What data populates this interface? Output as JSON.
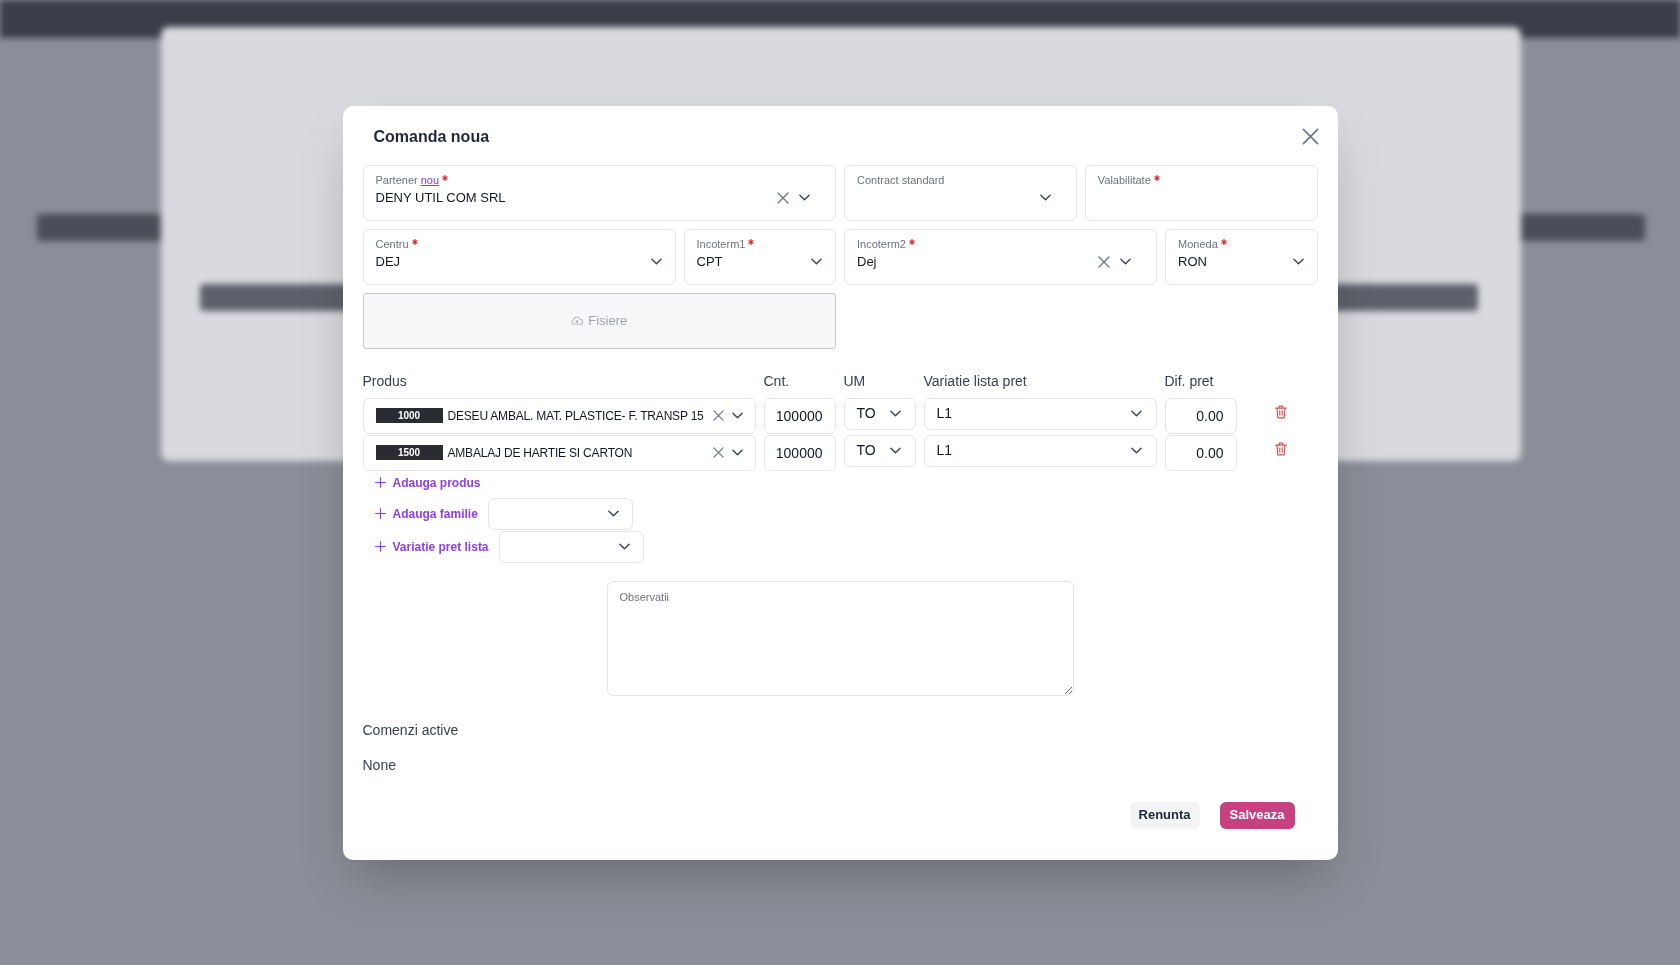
{
  "dialog": {
    "title": "Comanda noua",
    "header_fields": [
      {
        "kind": "select",
        "label": "Partener",
        "link": "nou",
        "required": true,
        "value": "DENY UTIL COM SRL",
        "clearable": true
      },
      {
        "kind": "select",
        "label": "Contract standard",
        "required": false,
        "clearable": false
      },
      {
        "kind": "input",
        "label": "Valabilitate",
        "required": true,
        "clearable": false
      },
      {
        "kind": "select",
        "label": "Centru",
        "required": true,
        "value": "DEJ",
        "clearable": false
      },
      {
        "kind": "select",
        "label": "Incoterm1",
        "required": true,
        "value": "CPT",
        "clearable": false
      },
      {
        "kind": "select",
        "label": "Incoterm2",
        "required": true,
        "value": "Dej",
        "clearable": true
      },
      {
        "kind": "select",
        "label": "Moneda",
        "required": true,
        "value": "RON",
        "clearable": false
      }
    ],
    "upload": {
      "label": "Fisiere"
    },
    "products": {
      "columns": [
        "Produs",
        "Cnt.",
        "UM",
        "Variatie lista pret",
        "Dif. pret"
      ],
      "rows": [
        {
          "code": "1000",
          "name": "DESEU AMBAL. MAT. PLASTICE- F. TRANSP 15",
          "quantity": "100000",
          "unit": "TO",
          "price_list_variation": "L1",
          "price_difference": "0.00"
        },
        {
          "code": "1500",
          "name": "AMBALAJ DE HARTIE SI CARTON",
          "quantity": "100000",
          "unit": "TO",
          "price_list_variation": "L1",
          "price_difference": "0.00"
        }
      ]
    },
    "actions": [
      {
        "kind": "link",
        "label": "Adauga produs"
      },
      {
        "kind": "link_with_select",
        "label": "Adauga familie"
      },
      {
        "kind": "link_with_select",
        "label": "Variatie pret lista"
      }
    ],
    "notes": {
      "placeholder": "Observatii"
    },
    "active_orders": {
      "title": "Comenzi active",
      "text": "None"
    },
    "buttons": [
      {
        "kind": "secondary",
        "label": "Renunta"
      },
      {
        "kind": "primary",
        "label": "Salveaza"
      }
    ]
  }
}
